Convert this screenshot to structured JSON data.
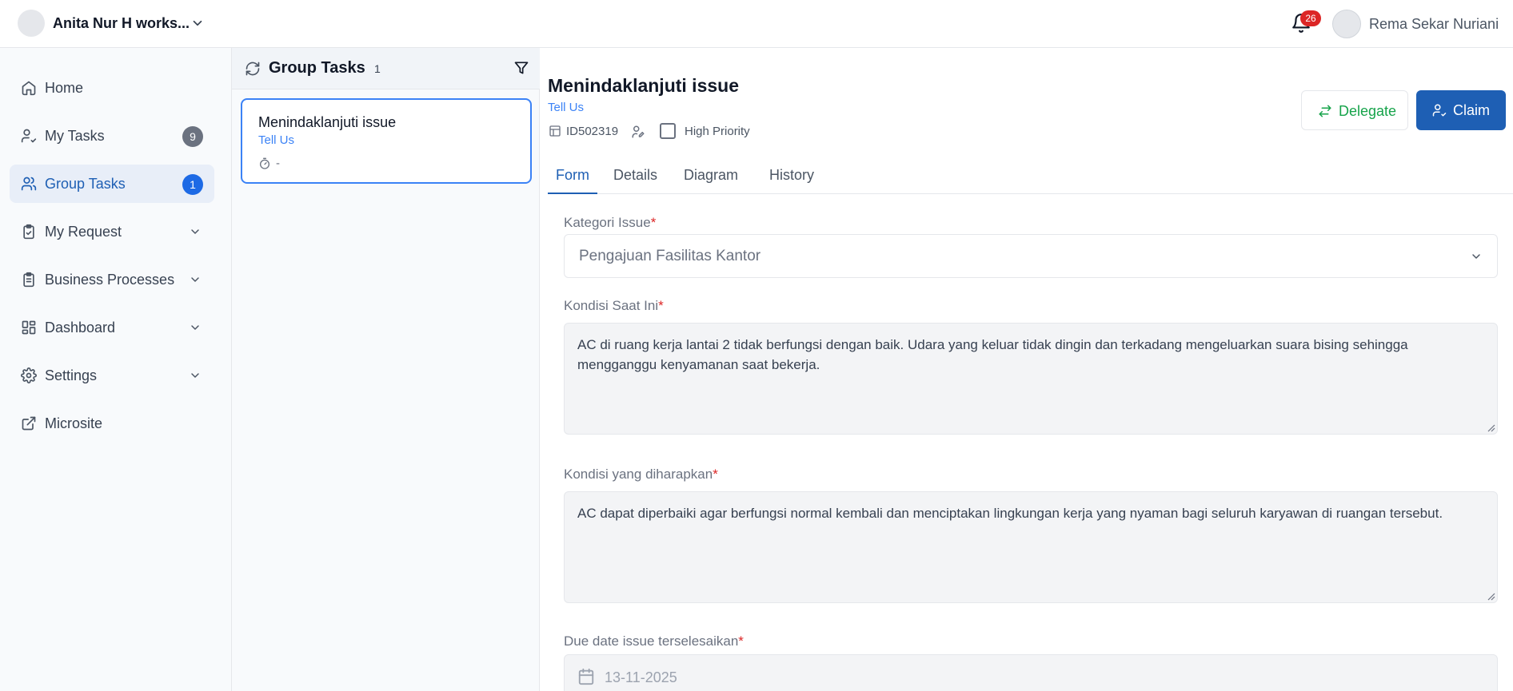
{
  "topbar": {
    "workspace_name": "Anita Nur H works...",
    "notification_count": "26",
    "user_name": "Rema Sekar Nuriani"
  },
  "sidebar": {
    "items": [
      {
        "label": "Home",
        "icon": "home-icon"
      },
      {
        "label": "My Tasks",
        "icon": "user-check-icon",
        "badge": "9"
      },
      {
        "label": "Group Tasks",
        "icon": "users-icon",
        "badge": "1",
        "active": true
      },
      {
        "label": "My Request",
        "icon": "clipboard-check-icon",
        "expandable": true
      },
      {
        "label": "Business Processes",
        "icon": "clipboard-list-icon",
        "expandable": true
      },
      {
        "label": "Dashboard",
        "icon": "dashboard-grid-icon",
        "expandable": true
      },
      {
        "label": "Settings",
        "icon": "gear-icon",
        "expandable": true
      },
      {
        "label": "Microsite",
        "icon": "external-link-icon"
      }
    ]
  },
  "tasklist": {
    "title": "Group Tasks",
    "count": "1",
    "tasks": [
      {
        "title": "Menindaklanjuti issue",
        "subtitle": "Tell Us",
        "due": "-"
      }
    ]
  },
  "detail": {
    "title": "Menindaklanjuti issue",
    "subtitle": "Tell Us",
    "id": "ID502319",
    "priority_label": "High Priority",
    "priority_checked": false,
    "delegate_label": "Delegate",
    "claim_label": "Claim",
    "tabs": [
      "Form",
      "Details",
      "Diagram",
      "History"
    ],
    "active_tab": "Form",
    "form": {
      "kategori_label": "Kategori Issue",
      "kategori_value": "Pengajuan Fasilitas Kantor",
      "kondisi_saat_ini_label": "Kondisi Saat Ini",
      "kondisi_saat_ini_value": "AC di ruang kerja lantai 2 tidak berfungsi dengan baik. Udara yang keluar tidak dingin dan terkadang mengeluarkan suara bising sehingga mengganggu kenyamanan saat bekerja.",
      "kondisi_diharapkan_label": "Kondisi yang diharapkan",
      "kondisi_diharapkan_value": "AC dapat diperbaiki agar berfungsi normal kembali dan menciptakan lingkungan kerja yang nyaman bagi seluruh karyawan di ruangan tersebut.",
      "due_date_label": "Due date issue terselesaikan",
      "due_date_value": "13-11-2025",
      "required_marker": "*"
    }
  },
  "colors": {
    "primary": "#1e5fb4",
    "link": "#3b82f6",
    "delegate": "#16a34a",
    "badge_red": "#dc2626",
    "active_nav_bg": "#e8eef8"
  }
}
